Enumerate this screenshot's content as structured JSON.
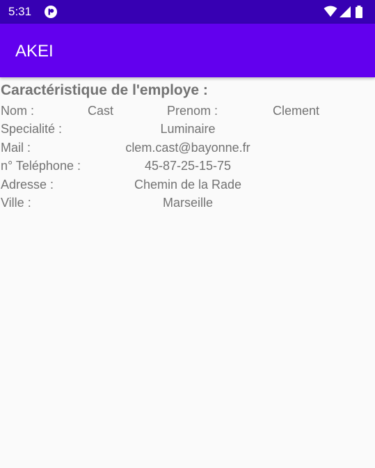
{
  "status_bar": {
    "time": "5:31"
  },
  "app_bar": {
    "title": "AKEI"
  },
  "employee": {
    "section_title": "Caractéristique de l'employe :",
    "nom_label": "Nom :",
    "nom_value": "Cast",
    "prenom_label": "Prenom :",
    "prenom_value": "Clement",
    "specialite_label": "Specialité :",
    "specialite_value": "Luminaire",
    "mail_label": "Mail :",
    "mail_value": "clem.cast@bayonne.fr",
    "telephone_label": "n° Teléphone :",
    "telephone_value": "45-87-25-15-75",
    "adresse_label": "Adresse :",
    "adresse_value": "Chemin de la Rade",
    "ville_label": "Ville :",
    "ville_value": "Marseille"
  },
  "colors": {
    "status_bar": "#3700b3",
    "app_bar": "#6200ee",
    "text": "#737373",
    "background": "#fafafa"
  },
  "icons": [
    "app-notification-icon",
    "wifi-icon",
    "signal-icon",
    "battery-icon"
  ]
}
